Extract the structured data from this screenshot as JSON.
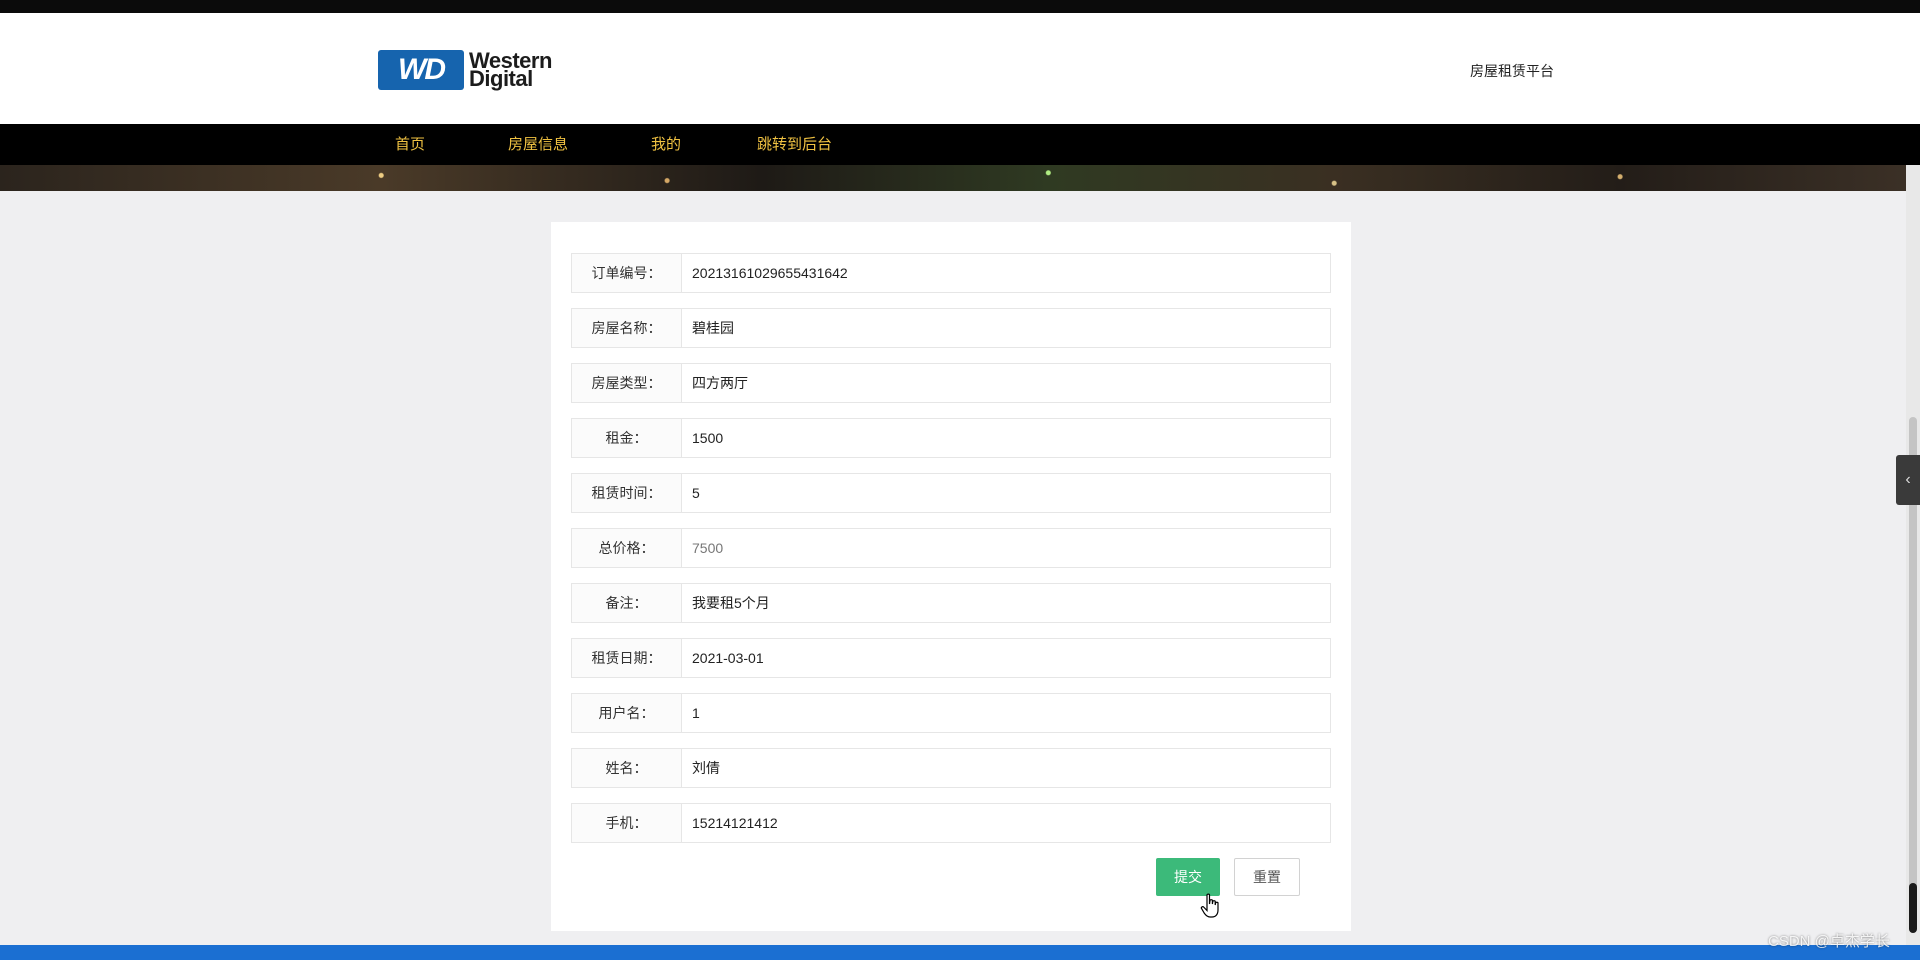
{
  "header": {
    "logo_mark": "WD",
    "logo_line1": "Western",
    "logo_line2": "Digital",
    "site_title": "房屋租赁平台"
  },
  "nav": {
    "items": [
      "首页",
      "房屋信息",
      "我的",
      "跳转到后台"
    ]
  },
  "form": {
    "rows": [
      {
        "label": "订单编号：",
        "value": "20213161029655431642"
      },
      {
        "label": "房屋名称：",
        "value": "碧桂园"
      },
      {
        "label": "房屋类型：",
        "value": "四方两厅"
      },
      {
        "label": "租金：",
        "value": "1500"
      },
      {
        "label": "租赁时间：",
        "value": "5"
      },
      {
        "label": "总价格：",
        "value": "7500"
      },
      {
        "label": "备注：",
        "value": "我要租5个月"
      },
      {
        "label": "租赁日期：",
        "value": "2021-03-01"
      },
      {
        "label": "用户名：",
        "value": "1"
      },
      {
        "label": "姓名：",
        "value": "刘倩"
      },
      {
        "label": "手机：",
        "value": "15214121412"
      }
    ],
    "submit_label": "提交",
    "reset_label": "重置"
  },
  "colors": {
    "nav_bg": "#000000",
    "nav_text": "#f0c242",
    "submit_bg": "#3cba7a",
    "page_bg": "#efeff1"
  },
  "watermark": "CSDN @卓杰学长"
}
